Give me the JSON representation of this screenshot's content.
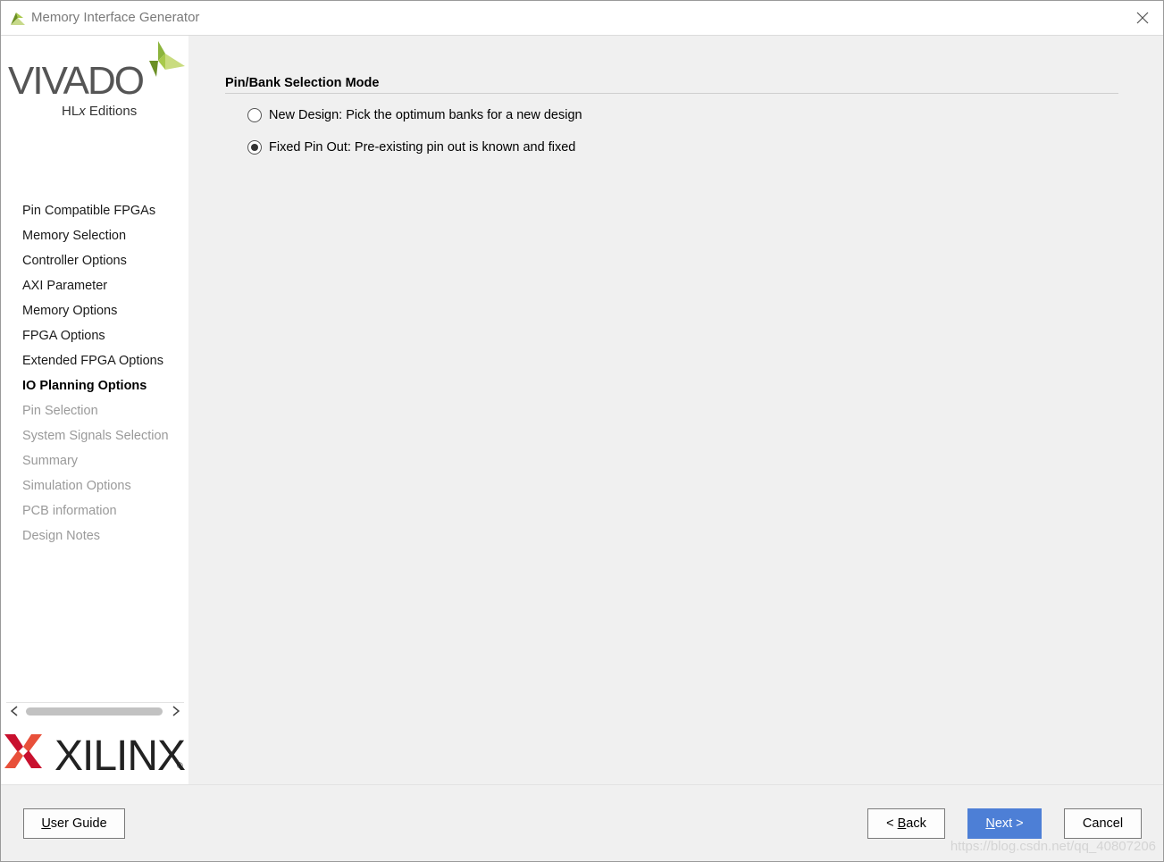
{
  "window": {
    "title": "Memory Interface Generator"
  },
  "branding": {
    "vivado": "VIVADO",
    "hlx_prefix": "HL",
    "hlx_x": "x",
    "hlx_suffix": " Editions",
    "xilinx": "XILINX",
    "registered": "®"
  },
  "sidebar": {
    "items": [
      {
        "label": "Pin Compatible FPGAs",
        "state": "done"
      },
      {
        "label": "Memory Selection",
        "state": "done"
      },
      {
        "label": "Controller Options",
        "state": "done"
      },
      {
        "label": "AXI Parameter",
        "state": "done"
      },
      {
        "label": "Memory Options",
        "state": "done"
      },
      {
        "label": "FPGA Options",
        "state": "done"
      },
      {
        "label": "Extended FPGA Options",
        "state": "done"
      },
      {
        "label": "IO Planning Options",
        "state": "current"
      },
      {
        "label": "Pin Selection",
        "state": "future"
      },
      {
        "label": "System Signals Selection",
        "state": "future"
      },
      {
        "label": "Summary",
        "state": "future"
      },
      {
        "label": "Simulation Options",
        "state": "future"
      },
      {
        "label": "PCB information",
        "state": "future"
      },
      {
        "label": "Design Notes",
        "state": "future"
      }
    ]
  },
  "main": {
    "section_title": "Pin/Bank Selection Mode",
    "options": [
      {
        "label": "New Design: Pick the optimum banks for a new design",
        "checked": false
      },
      {
        "label": "Fixed Pin Out: Pre-existing pin out is known and fixed",
        "checked": true
      }
    ]
  },
  "footer": {
    "user_guide_mnemonic": "U",
    "user_guide_rest": "ser Guide",
    "back_prefix": "< ",
    "back_mnemonic": "B",
    "back_rest": "ack",
    "next_mnemonic": "N",
    "next_rest": "ext >",
    "cancel": "Cancel",
    "watermark": "https://blog.csdn.net/qq_40807206"
  },
  "colors": {
    "primary_button": "#4d7fd6",
    "xilinx_red": "#c8102e",
    "vivado_green": "#8cb43c"
  }
}
